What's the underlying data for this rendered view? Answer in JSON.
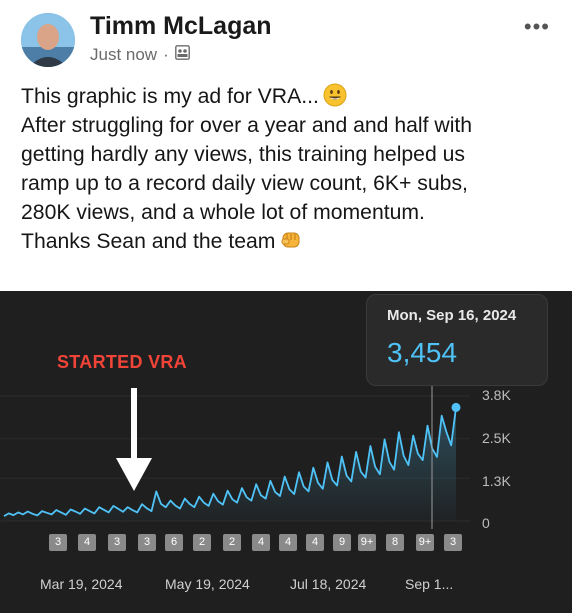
{
  "post": {
    "author": "Timm McLagan",
    "time": "Just now",
    "separator": "·",
    "more": "•••",
    "lines": [
      "This graphic is my ad for VRA...",
      "After struggling for over a year and and half with",
      "getting hardly any views, this training helped us",
      "ramp up to a record daily view count, 6K+ subs,",
      "280K views, and a whole lot of momentum.",
      "",
      "Thanks Sean and the team"
    ]
  },
  "chart": {
    "tooltip_date": "Mon, Sep 16, 2024",
    "tooltip_value": "3,454",
    "annotation": "STARTED VRA",
    "yticks": [
      "3.8K",
      "2.5K",
      "1.3K",
      "0"
    ],
    "xticks": [
      "Mar 19, 2024",
      "May 19, 2024",
      "Jul 18, 2024",
      "Sep 1..."
    ],
    "badges": [
      "3",
      "4",
      "3",
      "3",
      "6",
      "2",
      "2",
      "4",
      "4",
      "4",
      "9",
      "9+",
      "8",
      "9+",
      "3"
    ],
    "colors": {
      "line": "#4fc3f7",
      "accent": "#f04438"
    }
  },
  "chart_data": {
    "type": "line",
    "ylim": [
      0,
      3800
    ],
    "yticks": [
      "3.8K",
      "2.5K",
      "1.3K",
      "0"
    ],
    "xticks": [
      "Mar 19, 2024",
      "May 19, 2024",
      "Jul 18, 2024",
      "Sep 1..."
    ],
    "highlight": {
      "x": "Mon, Sep 16, 2024",
      "y": 3454
    },
    "y": [
      150,
      230,
      180,
      260,
      200,
      290,
      220,
      170,
      300,
      250,
      200,
      330,
      260,
      190,
      350,
      290,
      220,
      380,
      300,
      230,
      420,
      340,
      260,
      460,
      370,
      280,
      420,
      330,
      260,
      510,
      390,
      300,
      900,
      520,
      420,
      620,
      470,
      380,
      680,
      520,
      420,
      740,
      560,
      460,
      830,
      600,
      500,
      920,
      660,
      560,
      1000,
      720,
      620,
      1120,
      780,
      680,
      1220,
      880,
      760,
      1350,
      960,
      820,
      1480,
      1050,
      900,
      1620,
      1160,
      980,
      1780,
      1250,
      1080,
      1960,
      1380,
      1200,
      2100,
      1500,
      1320,
      2280,
      1650,
      1420,
      2480,
      1800,
      1560,
      2700,
      1980,
      1700,
      2600,
      2050,
      1850,
      2900,
      2200,
      1950,
      3200,
      2700,
      2300,
      3454
    ]
  }
}
